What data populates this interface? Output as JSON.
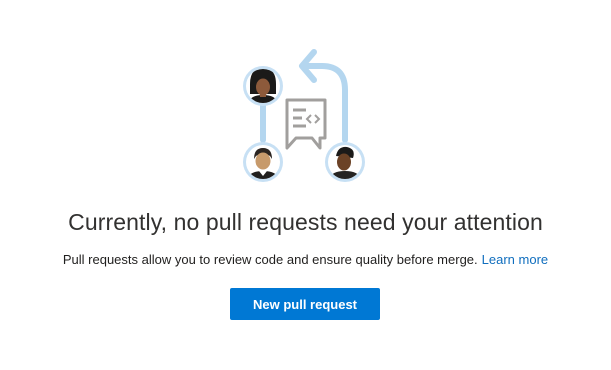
{
  "empty_state": {
    "illustration_icon": "pull-request-people-illustration",
    "headline": "Currently, no pull requests need your attention",
    "description": "Pull requests allow you to review code and ensure quality before merge.",
    "learn_more_label": "Learn more",
    "new_pr_button_label": "New pull request"
  },
  "colors": {
    "accent": "#0078d4",
    "link": "#106ebe",
    "illustration_track": "#b4d6ef",
    "avatar_ring": "#c7e0f4"
  }
}
